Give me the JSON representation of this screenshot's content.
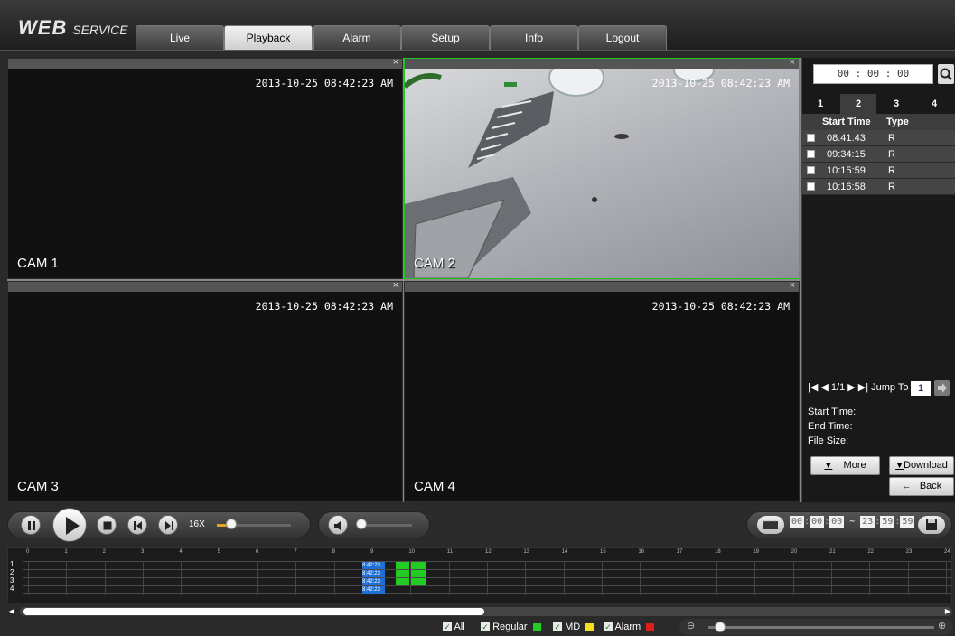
{
  "header": {
    "logo_main": "WEB",
    "logo_sub": "SERVICE",
    "tabs": [
      {
        "label": "Live"
      },
      {
        "label": "Playback"
      },
      {
        "label": "Alarm"
      },
      {
        "label": "Setup"
      },
      {
        "label": "Info"
      },
      {
        "label": "Logout"
      }
    ],
    "active_tab": "Playback"
  },
  "cameras": [
    {
      "name": "CAM 1",
      "timestamp": "2013-10-25 08:42:23 AM"
    },
    {
      "name": "CAM 2",
      "timestamp": "2013-10-25 08:42:23 AM"
    },
    {
      "name": "CAM 3",
      "timestamp": "2013-10-25 08:42:23 AM"
    },
    {
      "name": "CAM 4",
      "timestamp": "2013-10-25 08:42:23 AM"
    }
  ],
  "close_glyph": "×",
  "right_panel": {
    "time_value": "00 : 00 : 00",
    "channel_tabs": [
      "1",
      "2",
      "3",
      "4"
    ],
    "active_channel": "2",
    "table_headers": {
      "start_time": "Start Time",
      "type": "Type"
    },
    "records": [
      {
        "start": "08:41:43",
        "type": "R"
      },
      {
        "start": "09:34:15",
        "type": "R"
      },
      {
        "start": "10:15:59",
        "type": "R"
      },
      {
        "start": "10:16:58",
        "type": "R"
      }
    ],
    "pager": {
      "text": "|◀ ◀ 1/1 ▶ ▶| Jump To",
      "jump_value": "1"
    },
    "info_labels": {
      "start_time": "Start Time:",
      "end_time": "End Time:",
      "file_size": "File Size:"
    },
    "buttons": {
      "more": "More",
      "download": "Download",
      "back": "Back"
    }
  },
  "controls": {
    "speed": "16X",
    "speed_progress": 0.2,
    "volume_level": 0.0,
    "range": {
      "start": [
        "00",
        "00",
        "00"
      ],
      "end": [
        "23",
        "59",
        "59"
      ]
    }
  },
  "timeline": {
    "hours": [
      "0",
      "1",
      "2",
      "3",
      "4",
      "5",
      "6",
      "7",
      "8",
      "9",
      "10",
      "11",
      "12",
      "13",
      "14",
      "15",
      "16",
      "17",
      "18",
      "19",
      "20",
      "21",
      "22",
      "23",
      "24"
    ],
    "rows": [
      "1",
      "2",
      "3",
      "4"
    ],
    "marker_label": "8:42:23"
  },
  "legend": {
    "all": "All",
    "regular": "Regular",
    "md": "MD",
    "alarm": "Alarm",
    "colors": {
      "regular": "#23cc23",
      "md": "#f3e21c",
      "alarm": "#e31c1c"
    }
  },
  "zoom_level": 0.05
}
